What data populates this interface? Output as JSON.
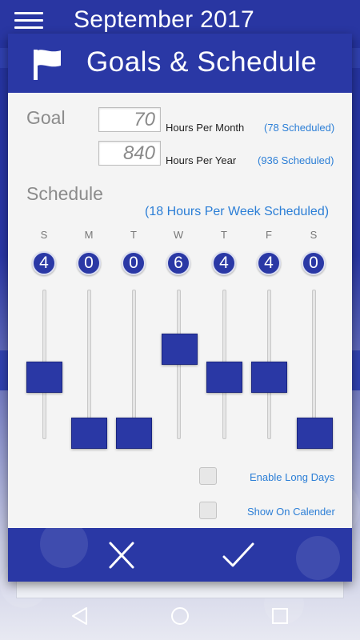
{
  "appbar": {
    "title": "September 2017"
  },
  "dialog": {
    "title": "Goals & Schedule",
    "goal": {
      "label": "Goal",
      "month": {
        "value": "70",
        "unit": "Hours Per Month",
        "scheduled": "(78 Scheduled)"
      },
      "year": {
        "value": "840",
        "unit": "Hours Per Year",
        "scheduled": "(936 Scheduled)"
      }
    },
    "schedule": {
      "label": "Schedule",
      "week_scheduled": "(18 Hours Per Week Scheduled)",
      "days": [
        {
          "letter": "S",
          "hours": "4"
        },
        {
          "letter": "M",
          "hours": "0"
        },
        {
          "letter": "T",
          "hours": "0"
        },
        {
          "letter": "W",
          "hours": "6"
        },
        {
          "letter": "T",
          "hours": "4"
        },
        {
          "letter": "F",
          "hours": "4"
        },
        {
          "letter": "S",
          "hours": "0"
        }
      ]
    },
    "options": {
      "enable_long_days": "Enable Long Days",
      "show_on_calendar": "Show On Calender"
    }
  },
  "colors": {
    "primary": "#2a38a5",
    "link": "#2b7ed6",
    "dialog_bg": "#f4f4f4"
  },
  "icons": {
    "menu": "hamburger-icon",
    "flag": "flag-icon",
    "cancel": "close-icon",
    "confirm": "check-icon",
    "back": "back-triangle-icon",
    "home": "home-circle-icon",
    "recents": "recents-square-icon"
  }
}
